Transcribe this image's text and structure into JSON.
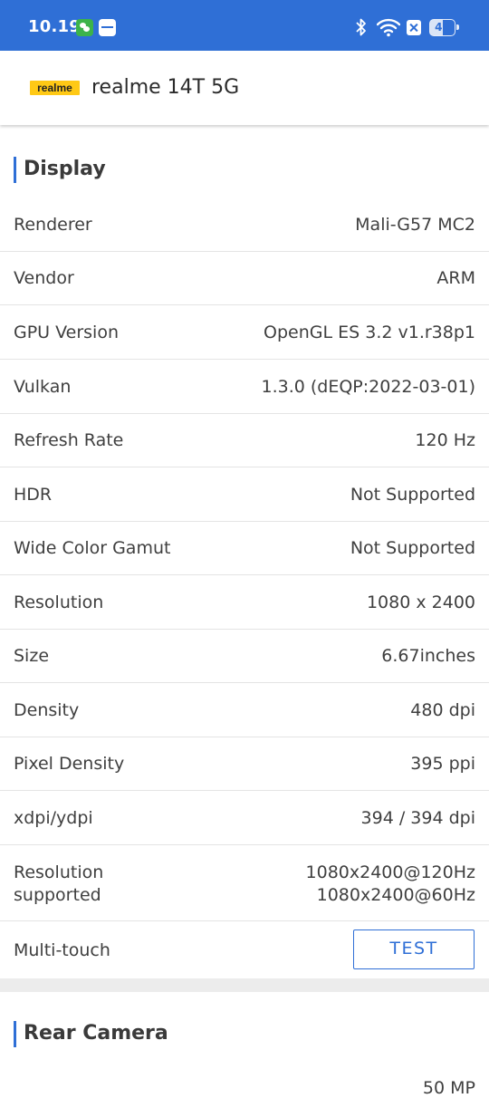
{
  "status_bar": {
    "time": "10.19",
    "battery_level": "45",
    "icons": [
      "wechat-icon",
      "message-icon",
      "bluetooth-icon",
      "wifi-icon",
      "no-sim-icon",
      "battery-icon"
    ],
    "background_color": "#2f6fd6"
  },
  "app_bar": {
    "logo_text": "realme",
    "logo_color": "#ffc915",
    "device_name": "realme 14T 5G"
  },
  "display_section": {
    "title": "Display",
    "rows": [
      {
        "label": "Renderer",
        "value": "Mali-G57 MC2"
      },
      {
        "label": "Vendor",
        "value": "ARM"
      },
      {
        "label": "GPU Version",
        "value": "OpenGL ES 3.2 v1.r38p1"
      },
      {
        "label": "Vulkan",
        "value": "1.3.0 (dEQP:2022-03-01)"
      },
      {
        "label": "Refresh Rate",
        "value": "120 Hz"
      },
      {
        "label": "HDR",
        "value": "Not Supported"
      },
      {
        "label": "Wide Color Gamut",
        "value": "Not Supported"
      },
      {
        "label": "Resolution",
        "value": "1080 x 2400"
      },
      {
        "label": "Size",
        "value": "6.67inches"
      },
      {
        "label": "Density",
        "value": "480 dpi"
      },
      {
        "label": "Pixel Density",
        "value": "395 ppi"
      },
      {
        "label": "xdpi/ydpi",
        "value": "394 / 394 dpi"
      }
    ],
    "resolution_supported": {
      "label_line1": "Resolution",
      "label_line2": "supported",
      "value_line1": "1080x2400@120Hz",
      "value_line2": "1080x2400@60Hz"
    },
    "multi_touch": {
      "label": "Multi-touch",
      "button_label": "TEST"
    }
  },
  "rear_camera_section": {
    "title": "Rear Camera",
    "partial_value": "50 MP"
  },
  "accent_color": "#2f6fd6"
}
